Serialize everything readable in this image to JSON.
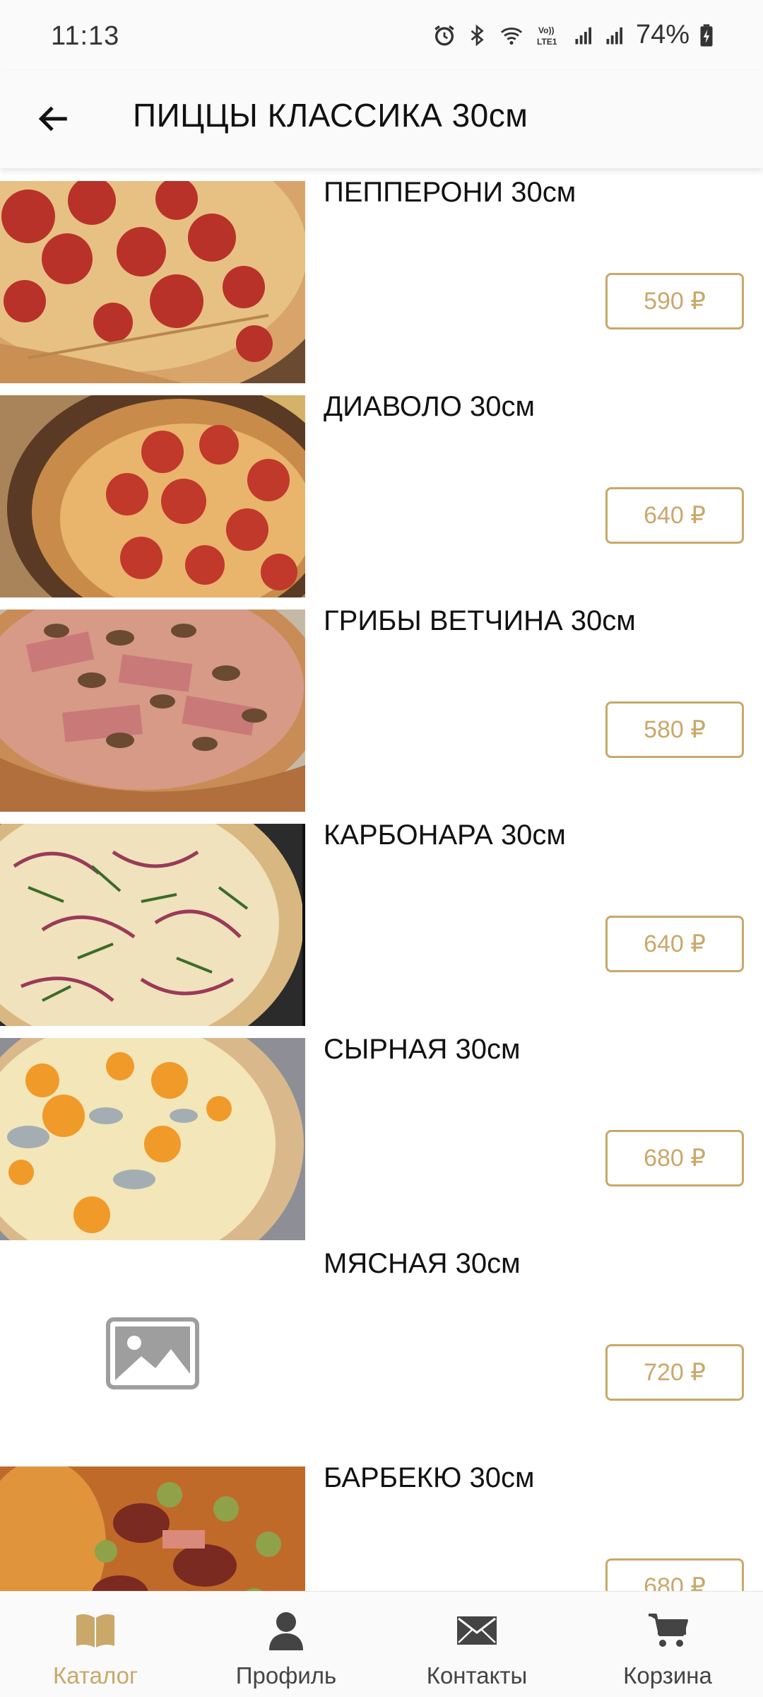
{
  "status_bar": {
    "time": "11:13",
    "battery": "74%",
    "icons": [
      "alarm-icon",
      "bluetooth-icon",
      "wifi-icon",
      "volte-icon",
      "signal-icon",
      "signal-icon",
      "battery-charging-icon"
    ]
  },
  "header": {
    "title": "ПИЦЦЫ КЛАССИКА 30см",
    "back_icon": "arrow-left-icon"
  },
  "products": [
    {
      "name": "ПЕППЕРОНИ 30см",
      "price": "590 ₽",
      "image": "pepperoni"
    },
    {
      "name": "ДИАВОЛО 30см",
      "price": "640 ₽",
      "image": "diavolo"
    },
    {
      "name": "ГРИБЫ ВЕТЧИНА 30см",
      "price": "580 ₽",
      "image": "mushroom-ham"
    },
    {
      "name": "КАРБОНАРА 30см",
      "price": "640 ₽",
      "image": "carbonara"
    },
    {
      "name": "СЫРНАЯ 30см",
      "price": "680 ₽",
      "image": "cheese"
    },
    {
      "name": "МЯСНАЯ 30см",
      "price": "720 ₽",
      "image": "placeholder"
    },
    {
      "name": "БАРБЕКЮ 30см",
      "price": "680 ₽",
      "image": "bbq"
    }
  ],
  "bottom_nav": {
    "items": [
      {
        "label": "Каталог",
        "icon": "book-icon",
        "active": true
      },
      {
        "label": "Профиль",
        "icon": "person-icon",
        "active": false
      },
      {
        "label": "Контакты",
        "icon": "envelope-icon",
        "active": false
      },
      {
        "label": "Корзина",
        "icon": "cart-icon",
        "active": false
      }
    ]
  },
  "colors": {
    "accent": "#c9a86a",
    "background": "#ffffff",
    "bar_background": "#fafafa",
    "text": "#111111"
  }
}
